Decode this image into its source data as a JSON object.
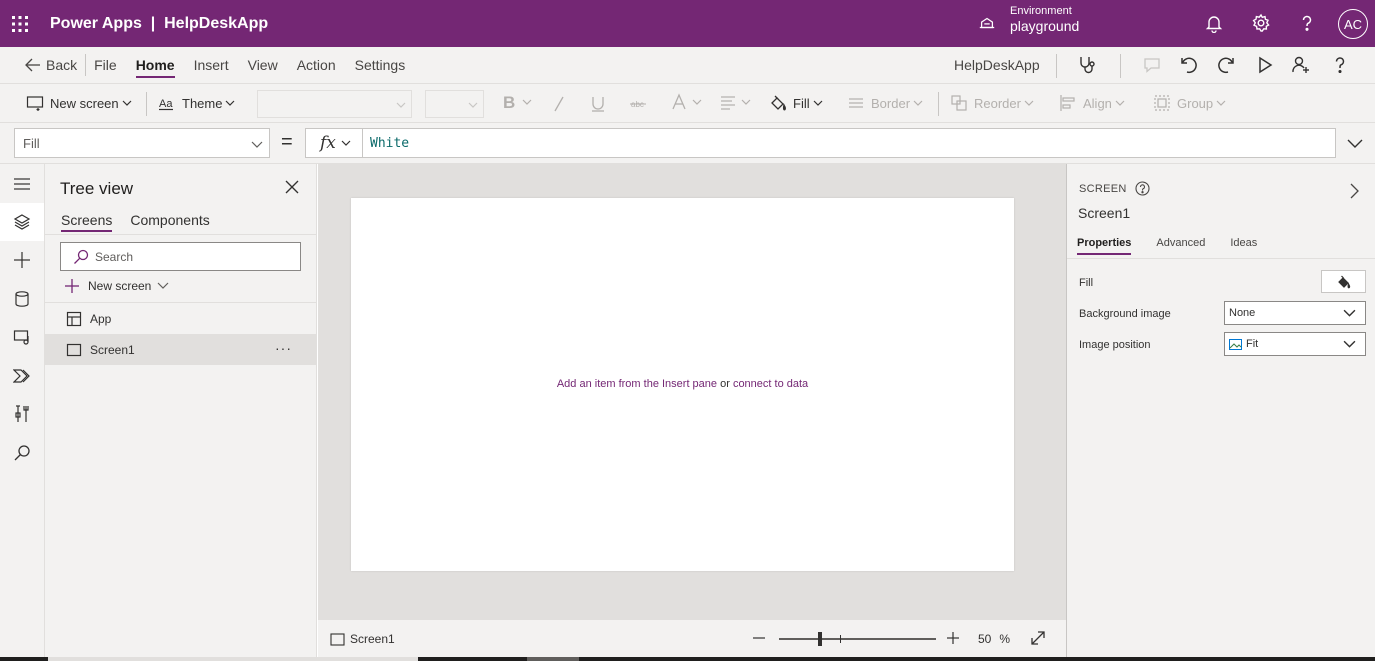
{
  "topbar": {
    "app_title": "Power Apps  |  HelpDeskApp",
    "environment_label": "Environment",
    "environment_value": "playground",
    "avatar_initials": "AC"
  },
  "menubar": {
    "back_label": "Back",
    "items": [
      "File",
      "Home",
      "Insert",
      "View",
      "Action",
      "Settings"
    ],
    "active_item": "Home",
    "app_name": "HelpDeskApp"
  },
  "toolbar": {
    "new_screen": "New screen",
    "theme": "Theme",
    "fill": "Fill",
    "border": "Border",
    "reorder": "Reorder",
    "align": "Align",
    "group": "Group"
  },
  "formula": {
    "property": "Fill",
    "equals": "=",
    "fx": "fx",
    "value": "White"
  },
  "treeview": {
    "title": "Tree view",
    "tabs": [
      "Screens",
      "Components"
    ],
    "search_placeholder": "Search",
    "new_screen": "New screen",
    "items": [
      "App",
      "Screen1"
    ],
    "more": "···"
  },
  "canvas": {
    "hint_prefix": "Add an item from the Insert pane",
    "hint_or": "or",
    "hint_link": "connect to data"
  },
  "statusbar": {
    "screen": "Screen1",
    "zoom_value": "50",
    "zoom_unit": "%",
    "zoom_fraction": 0.25
  },
  "properties": {
    "kind": "SCREEN",
    "screen_name": "Screen1",
    "tabs": [
      "Properties",
      "Advanced",
      "Ideas"
    ],
    "fill_label": "Fill",
    "background_image_label": "Background image",
    "background_image_value": "None",
    "image_position_label": "Image position",
    "image_position_value": "Fit"
  },
  "colors": {
    "brand": "#742774",
    "formula_text": "#0b6a6a",
    "panel_bg": "#f3f2f1",
    "canvas_bg": "#e1dfdd"
  }
}
